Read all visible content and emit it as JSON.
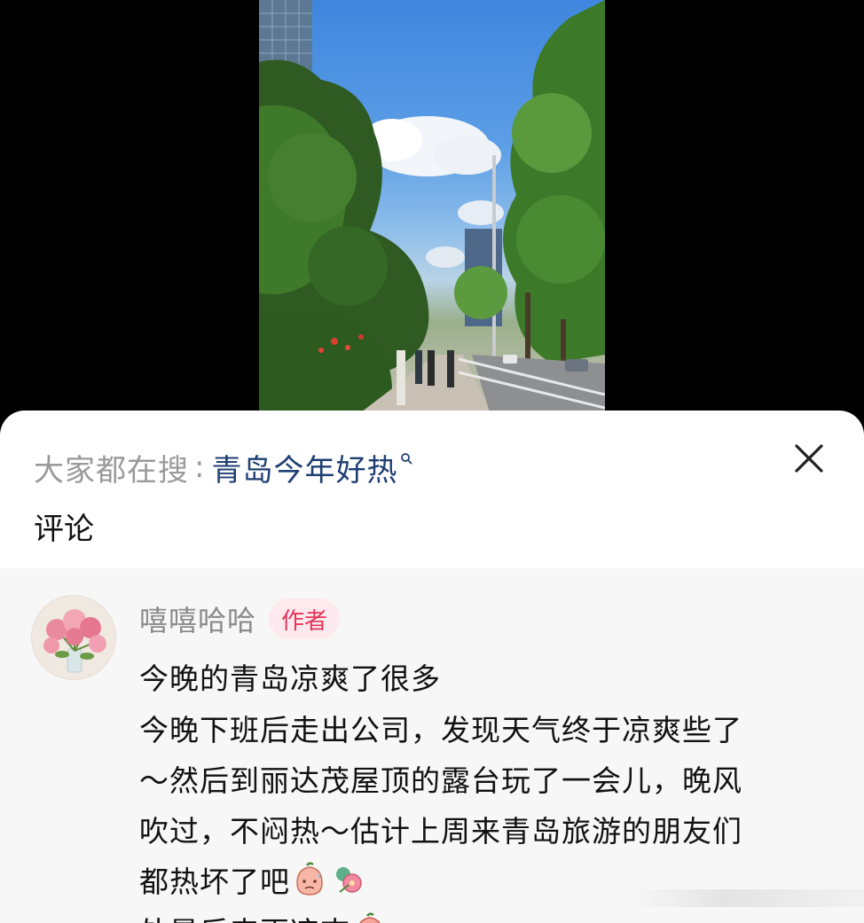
{
  "search_bar": {
    "prefix": "大家都在搜",
    "separator": ":",
    "term": "青岛今年好热",
    "close_icon": "close-icon"
  },
  "comments_section": {
    "title": "评论"
  },
  "comment": {
    "author": "嘻嘻哈哈",
    "author_badge": "作者",
    "title": "今晚的青岛凉爽了很多",
    "body_lines": [
      "今晚下班后走出公司，发现天气终于凉爽些了",
      "～然后到丽达茂屋顶的露台玩了一会儿，晚风",
      "吹过，不闷热～估计上周来青岛旅游的朋友们",
      "都热坏了吧",
      "处暑后来更凉爽"
    ],
    "emojis": [
      "peach-sweat-emoji",
      "peach-flower-emoji",
      "peach-cool-emoji"
    ]
  },
  "colors": {
    "search_term": "#1f3f73",
    "badge_text": "#e6345a",
    "badge_bg": "#fde9ee",
    "comment_bg": "#f7f7f7"
  }
}
